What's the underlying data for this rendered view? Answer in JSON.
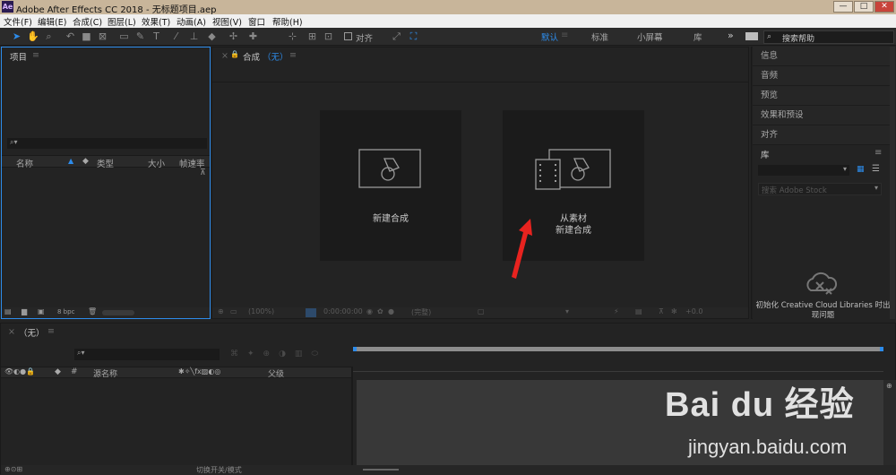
{
  "titlebar": {
    "app_icon": "Ae",
    "title": "Adobe After Effects CC 2018 - 无标题项目.aep",
    "minimize": "—",
    "maximize": "□",
    "close": "✕"
  },
  "menu": [
    "文件(F)",
    "编辑(E)",
    "合成(C)",
    "图层(L)",
    "效果(T)",
    "动画(A)",
    "视图(V)",
    "窗口",
    "帮助(H)"
  ],
  "toolbar": {
    "align_label": "对齐",
    "workspaces": [
      "默认",
      "标准",
      "小屏幕",
      "库"
    ],
    "more": "»",
    "search_placeholder": "搜索帮助"
  },
  "project": {
    "title": "项目",
    "menu_icon": "≡",
    "columns": [
      "名称",
      "类型",
      "大小",
      "帧速率"
    ],
    "bpc": "8 bpc"
  },
  "composition": {
    "tab_close": "×",
    "tab_label": "合成",
    "tab_value": "（无）",
    "new_comp_label": "新建合成",
    "from_footage_line1": "从素材",
    "from_footage_line2": "新建合成",
    "footer": {
      "zoom": "(100%)",
      "timecode": "0:00:00:00",
      "resolution": "(完整)",
      "exposure": "+0.0"
    }
  },
  "right_panels": {
    "items": [
      "信息",
      "音频",
      "预览",
      "效果和预设",
      "对齐"
    ],
    "library_title": "库",
    "library_search_placeholder": "搜索 Adobe Stock",
    "library_message_line1": "初始化 Creative Cloud Libraries 时出",
    "library_message_line2": "现问题"
  },
  "timeline": {
    "tab_close": "×",
    "tab_label": "（无）",
    "col_hash": "#",
    "col_source": "源名称",
    "col_parent": "父级",
    "footer_label": "切换开关/模式"
  },
  "watermark": {
    "brand": "Bai du 经验",
    "url": "jingyan.baidu.com"
  },
  "colors": {
    "accent_blue": "#2d8ceb",
    "annotation_red": "#e8231f",
    "panel_bg": "#232323"
  }
}
